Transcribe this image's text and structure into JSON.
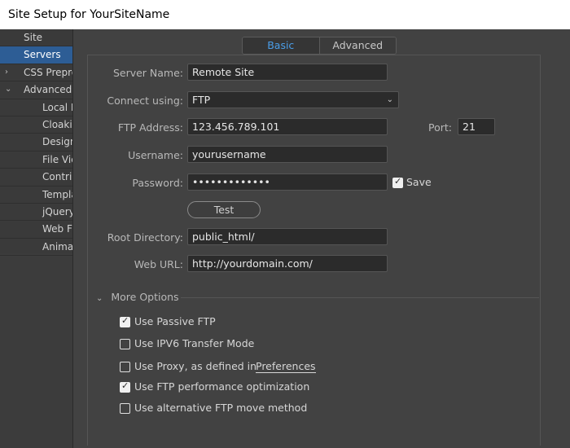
{
  "window": {
    "title": "Site Setup for YourSiteName"
  },
  "sidebar": {
    "items": [
      {
        "label": "Site",
        "selected": false
      },
      {
        "label": "Servers",
        "selected": true
      },
      {
        "label": "CSS Preprocessors",
        "selected": false
      },
      {
        "label": "Advanced Settings",
        "selected": false
      },
      {
        "label": "Local Info",
        "selected": false
      },
      {
        "label": "Cloaking",
        "selected": false
      },
      {
        "label": "Design Notes",
        "selected": false
      },
      {
        "label": "File View Columns",
        "selected": false
      },
      {
        "label": "Contribute",
        "selected": false
      },
      {
        "label": "Templates",
        "selected": false
      },
      {
        "label": "jQuery",
        "selected": false
      },
      {
        "label": "Web Fonts",
        "selected": false
      },
      {
        "label": "Animation Assets",
        "selected": false
      }
    ]
  },
  "tabs": {
    "basic": "Basic",
    "advanced": "Advanced",
    "active": "Basic"
  },
  "form": {
    "server_name_label": "Server Name:",
    "server_name_value": "Remote Site",
    "connect_label": "Connect using:",
    "connect_value": "FTP",
    "ftp_address_label": "FTP Address:",
    "ftp_address_value": "123.456.789.101",
    "port_label": "Port:",
    "port_value": "21",
    "username_label": "Username:",
    "username_value": "yourusername",
    "password_label": "Password:",
    "password_value": "•••••••••••••",
    "save_label": "Save",
    "save_checked": true,
    "test_button": "Test",
    "root_dir_label": "Root Directory:",
    "root_dir_value": "public_html/",
    "web_url_label": "Web URL:",
    "web_url_value": "http://yourdomain.com/"
  },
  "more_options": {
    "header": "More Options",
    "options": [
      {
        "label": "Use Passive FTP",
        "checked": true
      },
      {
        "label": "Use IPV6 Transfer Mode",
        "checked": false
      },
      {
        "label": "Use Proxy, as defined in",
        "checked": false
      },
      {
        "label": "Use FTP performance optimization",
        "checked": true
      },
      {
        "label": "Use alternative FTP move method",
        "checked": false
      }
    ],
    "preferences_link": "Preferences"
  }
}
